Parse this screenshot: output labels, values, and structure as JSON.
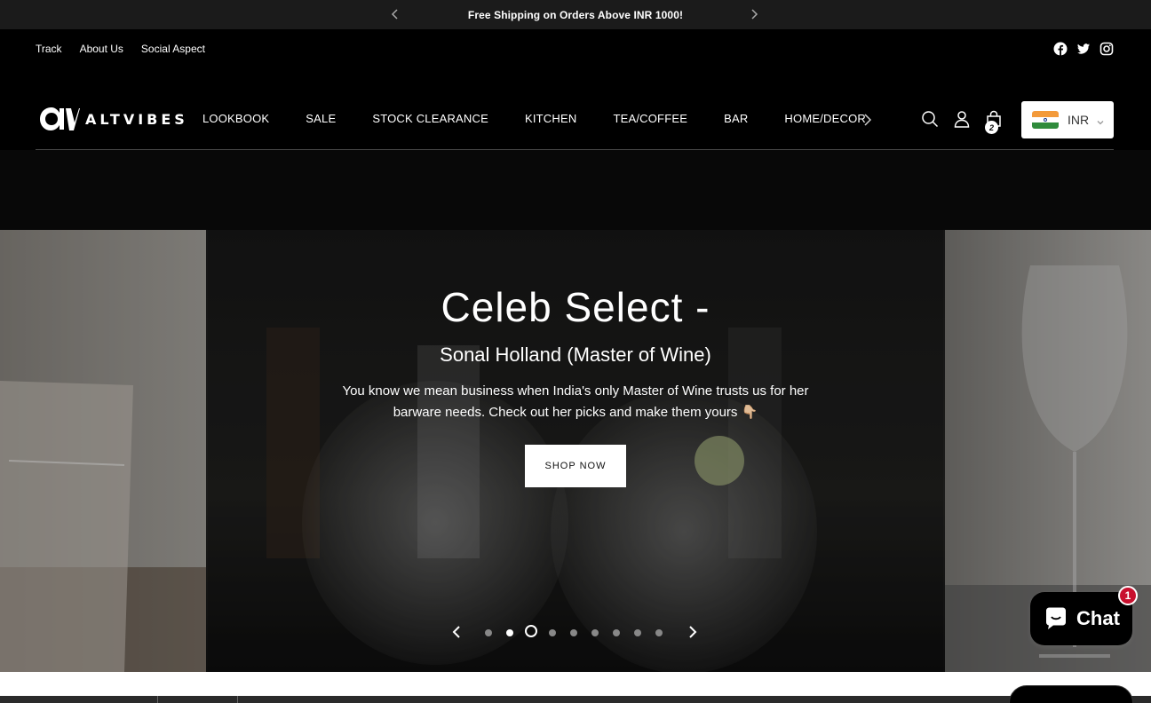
{
  "announcement": {
    "text": "Free Shipping on Orders Above INR 1000!"
  },
  "utility": {
    "links": [
      "Track",
      "About Us",
      "Social Aspect"
    ],
    "social_icons": [
      "facebook-icon",
      "twitter-icon",
      "instagram-icon"
    ]
  },
  "header": {
    "logo_text": "ALTVIBES",
    "nav": [
      "LOOKBOOK",
      "SALE",
      "STOCK CLEARANCE",
      "KITCHEN",
      "TEA/COFFEE",
      "BAR",
      "HOME/DECOR"
    ],
    "cart_count": "2",
    "currency": "INR"
  },
  "hero": {
    "title": "Celeb Select -",
    "subtitle": "Sonal Holland (Master of Wine)",
    "body": "You know we mean business when India's only Master of Wine trusts us for her barware needs. Check out her picks and make them yours 👇🏼",
    "button": "SHOP NOW",
    "slides_total": 9,
    "active_slide": 3
  },
  "chat": {
    "label": "Chat",
    "badge": "1"
  },
  "colors": {
    "announcement_bg": "#1b1b1b",
    "page_bg": "#000000",
    "chat_badge": "#c8102e"
  }
}
